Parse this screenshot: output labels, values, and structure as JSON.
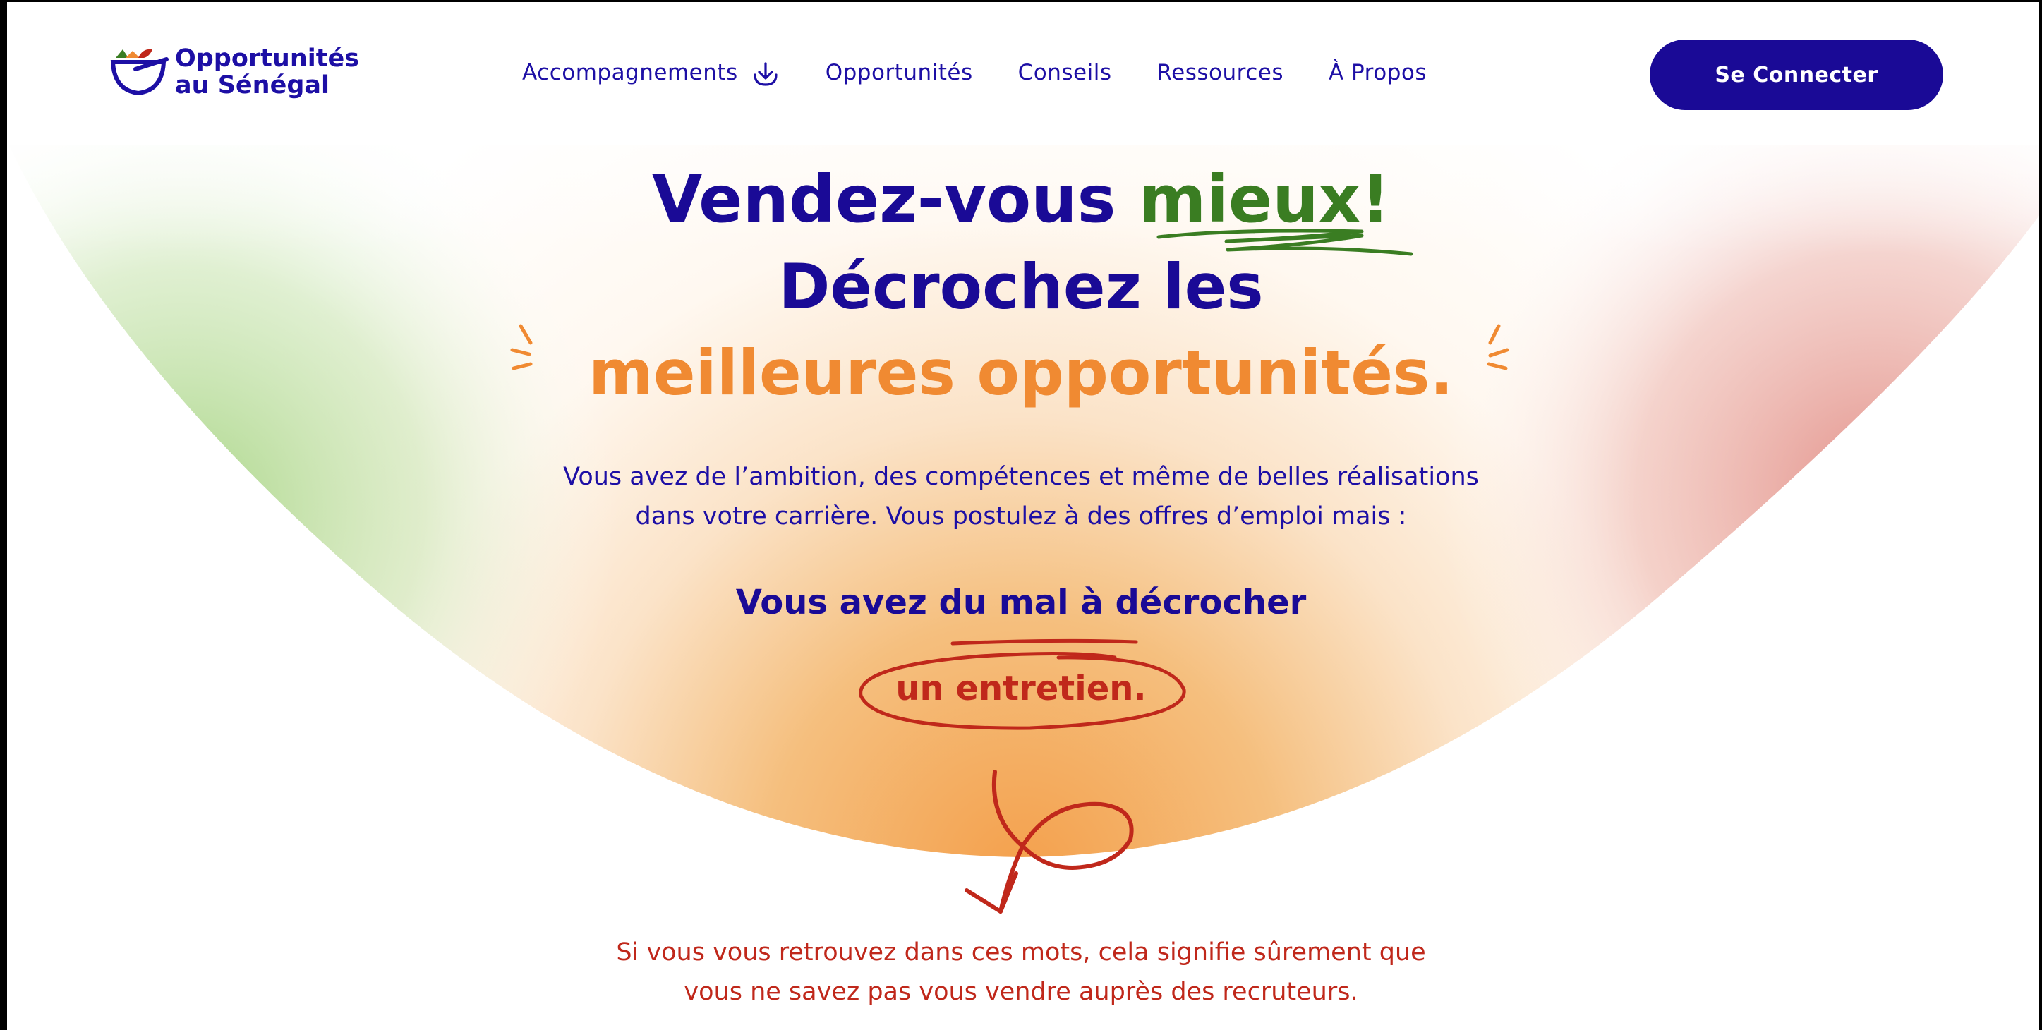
{
  "brand": {
    "name_line1": "Opportunités",
    "name_line2": "au Sénégal"
  },
  "nav": {
    "items": [
      {
        "label": "Accompagnements",
        "icon": "chevron-down-circle-icon"
      },
      {
        "label": "Opportunités"
      },
      {
        "label": "Conseils"
      },
      {
        "label": "Ressources"
      },
      {
        "label": "À Propos"
      }
    ]
  },
  "auth": {
    "login_label": "Se Connecter"
  },
  "hero": {
    "line1_part1": "Vendez-vous ",
    "line1_accent": "mieux!",
    "line2": "Décrochez les",
    "line3": "meilleures opportunités."
  },
  "intro": {
    "line1": "Vous avez de l’ambition, des compétences et même de belles réalisations",
    "line2": "dans votre carrière. Vous postulez à des offres d’emploi mais :"
  },
  "problem": {
    "main": "Vous avez du mal à décrocher",
    "accent": "un entretien."
  },
  "conclusion": {
    "line1": "Si vous vous retrouvez dans ces mots, cela signifie sûrement que",
    "line2": "vous ne savez pas vous vendre auprès des recruteurs."
  },
  "colors": {
    "primary": "#1a0a96",
    "green": "#3a7d22",
    "orange": "#f08a32",
    "red": "#c0281b"
  }
}
